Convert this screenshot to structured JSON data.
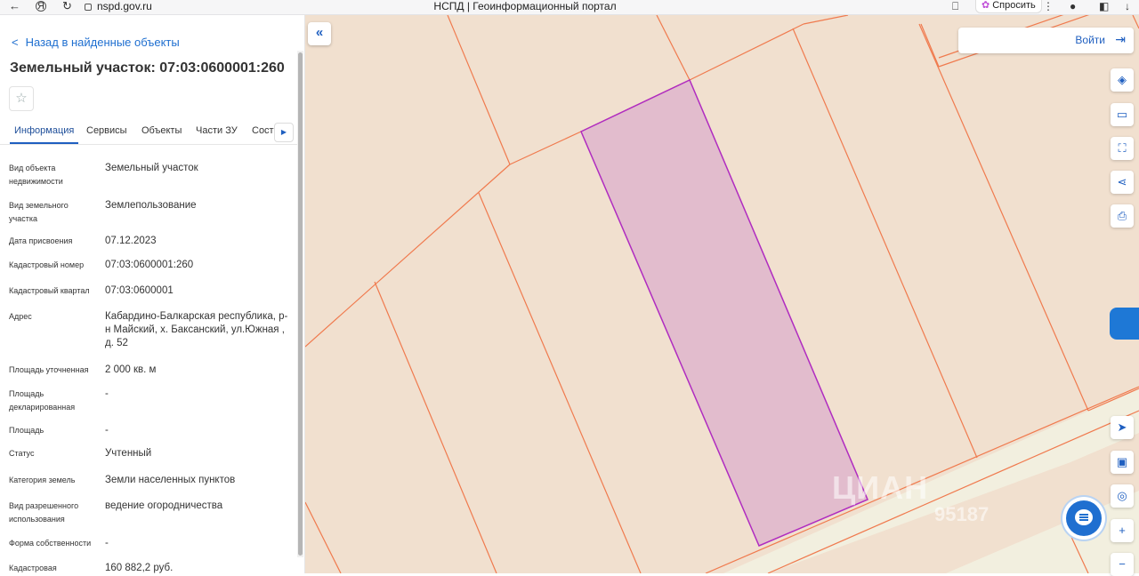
{
  "browser": {
    "url": "nspd.gov.ru",
    "title": "НСПД | Геоинформационный портал",
    "ask_label": "Спросить"
  },
  "sidebar": {
    "back_label": "Назад в найденные объекты",
    "title": "Земельный участок: 07:03:0600001:260",
    "tabs": [
      {
        "label": "Информация",
        "active": true
      },
      {
        "label": "Сервисы"
      },
      {
        "label": "Объекты"
      },
      {
        "label": "Части ЗУ"
      },
      {
        "label": "Соста"
      }
    ],
    "rows": [
      {
        "label": "Вид объекта недвижимости",
        "value": "Земельный участок"
      },
      {
        "label": "Вид земельного участка",
        "value": "Землепользование"
      },
      {
        "label": "Дата присвоения",
        "value": "07.12.2023"
      },
      {
        "label": "Кадастровый номер",
        "value": "07:03:0600001:260"
      },
      {
        "label": "Кадастровый квартал",
        "value": "07:03:0600001"
      },
      {
        "label": "Адрес",
        "value": "Кабардино-Балкарская республика, р-н Майский, х. Баксанский, ул.Южная , д. 52"
      },
      {
        "label": "Площадь уточненная",
        "value": "2 000 кв. м"
      },
      {
        "label": "Площадь декларированная",
        "value": "-"
      },
      {
        "label": "Площадь",
        "value": "-"
      },
      {
        "label": "Статус",
        "value": "Учтенный"
      },
      {
        "label": "Категория земель",
        "value": "Земли населенных пунктов"
      },
      {
        "label": "Вид разрешенного использования",
        "value": "ведение огородничества"
      },
      {
        "label": "Форма собственности",
        "value": "-"
      },
      {
        "label": "Кадастровая",
        "value": "160 882,2 руб."
      }
    ]
  },
  "map": {
    "login_label": "Войти",
    "colors": {
      "parcel_fill": "#e2bccd",
      "parcel_stroke": "#b02cc0",
      "boundary": "#f07a4e",
      "road": "#f2efdf",
      "background": "#f1e0cf"
    },
    "watermark": "ЦИАН",
    "watermark_id": "95187",
    "tools": [
      "layers-icon",
      "ruler-icon",
      "select-area-icon",
      "share-icon",
      "print-icon",
      "locate-icon",
      "minimap-icon",
      "geolocation-icon",
      "zoom-in-icon",
      "zoom-out-icon"
    ]
  }
}
